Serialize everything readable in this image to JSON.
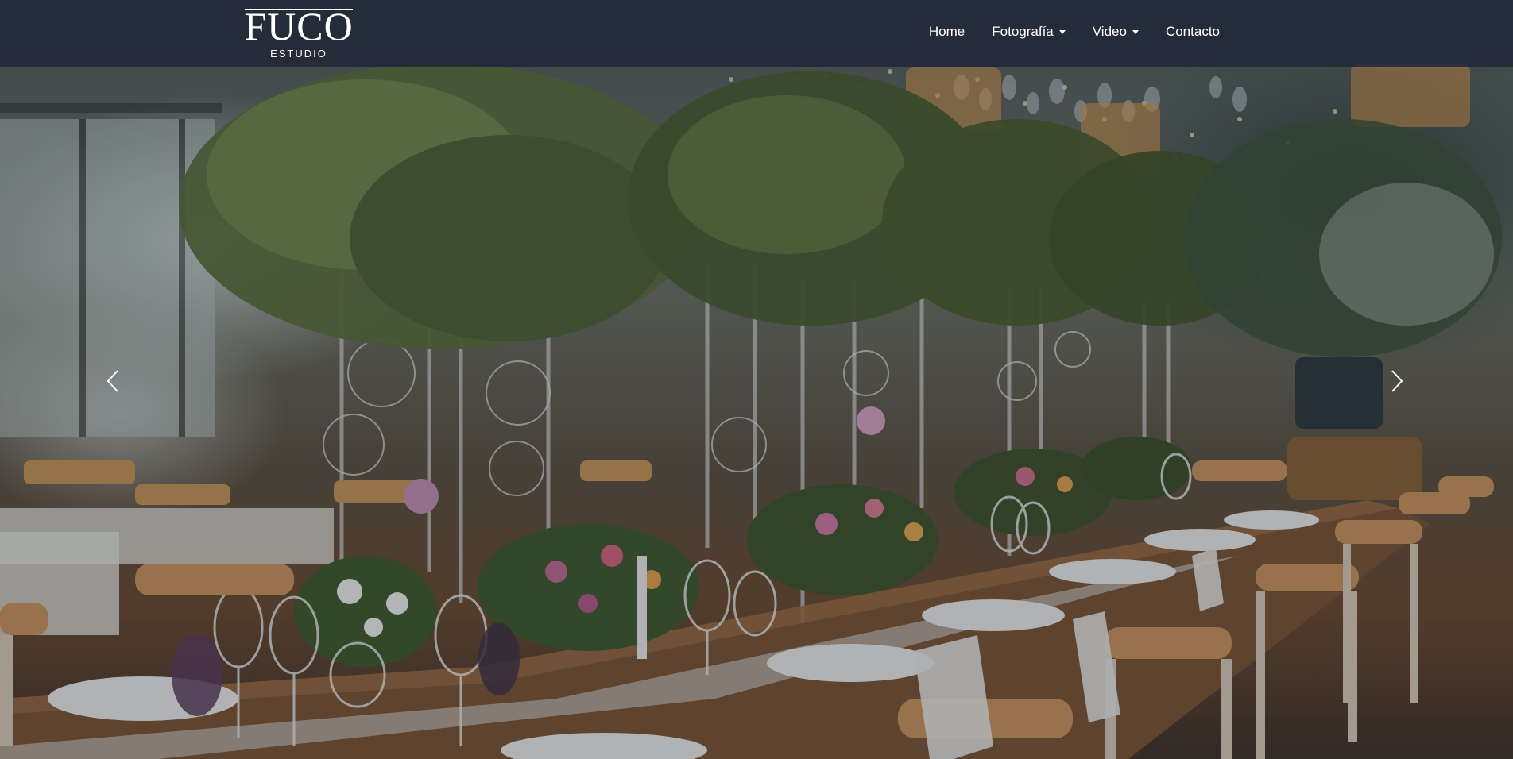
{
  "brand": {
    "name": "FUCO",
    "sub": "ESTUDIO"
  },
  "nav": {
    "items": [
      {
        "label": "Home",
        "dropdown": false
      },
      {
        "label": "Fotografía",
        "dropdown": true
      },
      {
        "label": "Video",
        "dropdown": true
      },
      {
        "label": "Contacto",
        "dropdown": false
      }
    ]
  },
  "carousel": {
    "prev_icon": "chevron-left-icon",
    "next_icon": "chevron-right-icon"
  },
  "colors": {
    "navbar": "#1e2436",
    "text": "#ffffff"
  }
}
